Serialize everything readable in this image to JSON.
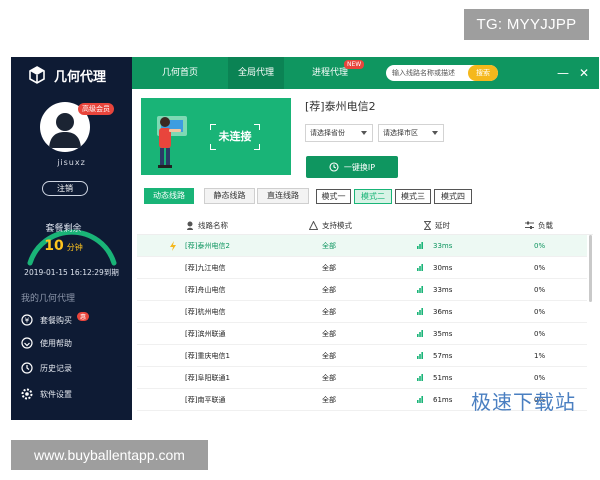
{
  "watermarks": {
    "top": "TG: MYYJJPP",
    "bottom": "www.buyballentapp.com",
    "site": "极速下载站"
  },
  "app": {
    "name": "几何代理",
    "colors": {
      "primary": "#0f9660",
      "sidebar": "#0e1b34",
      "accent": "#f5b81c",
      "badge": "#e8453c"
    }
  },
  "sidebar": {
    "vip_badge": "高级会员",
    "username": "jisuxz",
    "logout_label": "注销",
    "plan_label": "套餐剩余",
    "plan_value": "10",
    "plan_unit": "分钟",
    "expire": "2019-01-15 16:12:29到期",
    "section_label": "我的几何代理",
    "items": [
      {
        "label": "套餐购买",
        "icon": "package-icon",
        "badge": "惠"
      },
      {
        "label": "使用帮助",
        "icon": "help-icon"
      },
      {
        "label": "历史记录",
        "icon": "history-icon"
      },
      {
        "label": "软件设置",
        "icon": "settings-icon"
      }
    ]
  },
  "header": {
    "nav": [
      "几何首页",
      "全局代理",
      "进程代理"
    ],
    "new_badge": "NEW",
    "search_placeholder": "输入线路名称或描述",
    "search_button": "搜索"
  },
  "connection": {
    "status": "未连接",
    "line_title": "[荐]泰州电信2",
    "province_select": "请选择省份",
    "city_select": "请选择市区",
    "switch_ip_label": "一键换IP"
  },
  "line_tabs": [
    "动态线路",
    "静态线路",
    "直连线路"
  ],
  "modes": [
    "模式一",
    "模式二",
    "模式三",
    "模式四"
  ],
  "table": {
    "headers": [
      "线路名称",
      "支持模式",
      "延时",
      "负载"
    ],
    "rows": [
      {
        "name": "[荐]泰州电信2",
        "mode": "全部",
        "latency": "33ms",
        "load": "0%"
      },
      {
        "name": "[荐]九江电信",
        "mode": "全部",
        "latency": "30ms",
        "load": "0%"
      },
      {
        "name": "[荐]舟山电信",
        "mode": "全部",
        "latency": "33ms",
        "load": "0%"
      },
      {
        "name": "[荐]杭州电信",
        "mode": "全部",
        "latency": "36ms",
        "load": "0%"
      },
      {
        "name": "[荐]滨州联通",
        "mode": "全部",
        "latency": "35ms",
        "load": "0%"
      },
      {
        "name": "[荐]重庆电信1",
        "mode": "全部",
        "latency": "57ms",
        "load": "1%"
      },
      {
        "name": "[荐]阜阳联通1",
        "mode": "全部",
        "latency": "51ms",
        "load": "0%"
      },
      {
        "name": "[荐]南平联通",
        "mode": "全部",
        "latency": "61ms",
        "load": "0%"
      }
    ]
  }
}
